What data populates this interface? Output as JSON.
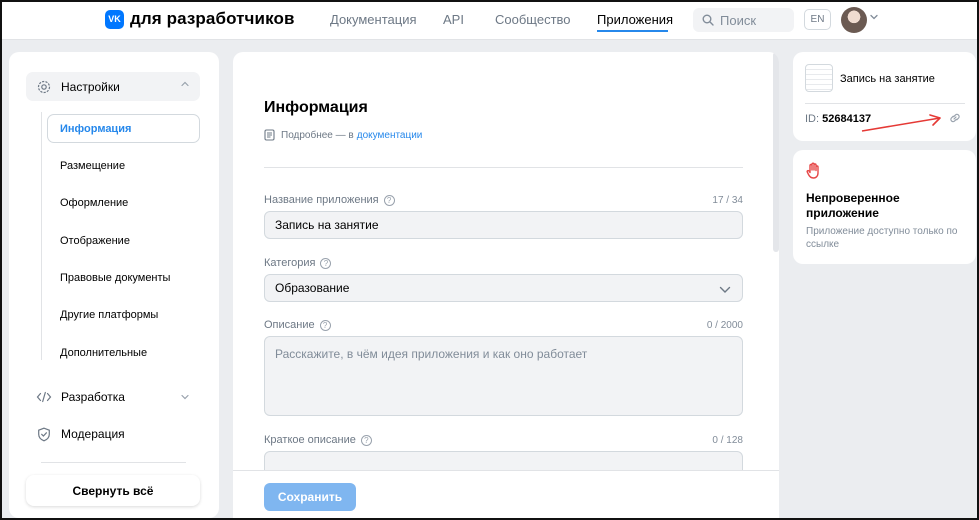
{
  "header": {
    "logo_mark": "VK",
    "logo_text": "для разработчиков",
    "nav": [
      "Документация",
      "API",
      "Сообщество",
      "Приложения"
    ],
    "active_nav": "Приложения",
    "search_placeholder": "Поиск",
    "lang": "EN"
  },
  "sidebar": {
    "settings_label": "Настройки",
    "sub_items": [
      "Информация",
      "Размещение",
      "Оформление",
      "Отображение",
      "Правовые документы",
      "Другие платформы",
      "Дополнительные"
    ],
    "dev_label": "Разработка",
    "moderation_label": "Модерация",
    "collapse_label": "Свернуть всё"
  },
  "main": {
    "title": "Информация",
    "more_prefix": "Подробнее — в",
    "more_link": "документации",
    "fields": {
      "name": {
        "label": "Название приложения",
        "count": "17 / 34",
        "value": "Запись на занятие"
      },
      "category": {
        "label": "Категория",
        "value": "Образование"
      },
      "description": {
        "label": "Описание",
        "count": "0 / 2000",
        "placeholder": "Расскажите, в чём идея приложения и как оно работает"
      },
      "short": {
        "label": "Краткое описание",
        "count": "0 / 128"
      }
    },
    "save_label": "Сохранить"
  },
  "app_card": {
    "name": "Запись на занятие",
    "id_label": "ID:",
    "id_value": "52684137"
  },
  "status_card": {
    "title": "Непроверенное приложение",
    "desc": "Приложение доступно только по ссылке"
  },
  "colors": {
    "accent": "#2688eb",
    "brand": "#0077ff",
    "warning": "#e64646",
    "annotation_arrow": "#e53935"
  }
}
